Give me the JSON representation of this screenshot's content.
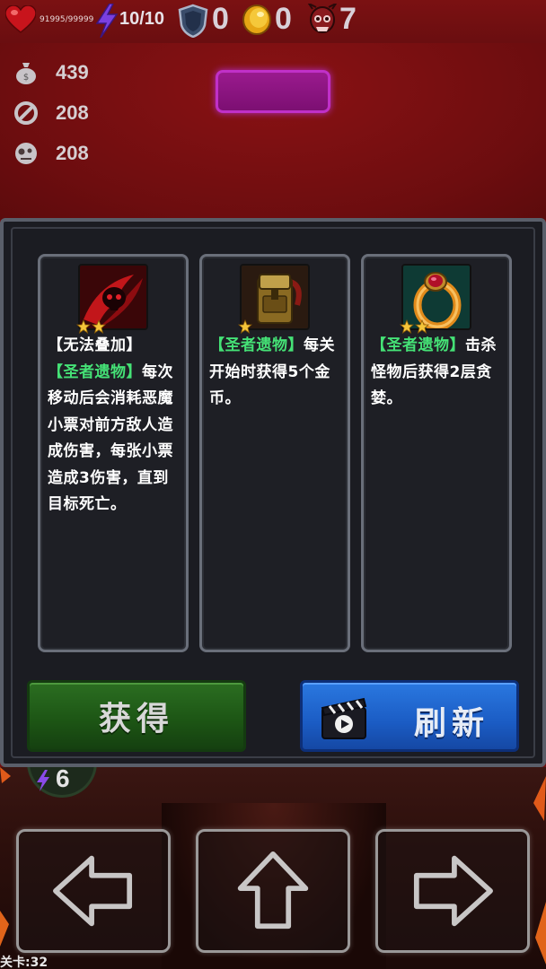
{
  "hud": {
    "hp": "91995/99999",
    "energy": "10/10",
    "shield": "0",
    "gold": "0",
    "kills": "7"
  },
  "stats": [
    {
      "icon": "money-bag-icon",
      "value": "439"
    },
    {
      "icon": "no-entry-icon",
      "value": "208"
    },
    {
      "icon": "skull-face-icon",
      "value": "208"
    }
  ],
  "cards": [
    {
      "stars": 2,
      "icon": "red-skull-relic-icon",
      "prefix": "【无法叠加】",
      "tag": "【圣者遗物】",
      "text": "每次移动后会消耗恶魔小票对前方敌人造成伤害，每张小票造成3伤害，直到目标死亡。"
    },
    {
      "stars": 1,
      "icon": "backpack-relic-icon",
      "prefix": "",
      "tag": "【圣者遗物】",
      "text": "每关开始时获得5个金币。"
    },
    {
      "stars": 2,
      "icon": "ruby-ring-relic-icon",
      "prefix": "",
      "tag": "【圣者遗物】",
      "text": "击杀怪物后获得2层贪婪。"
    }
  ],
  "buttons": {
    "get": "获得",
    "refresh": "刷新"
  },
  "player_energy": "6",
  "level": "关卡:32",
  "colors": {
    "tag_green": "#45e276",
    "get_button": "#1c5414",
    "refresh_button": "#1b5cc4",
    "background_red": "#6e0f10"
  }
}
